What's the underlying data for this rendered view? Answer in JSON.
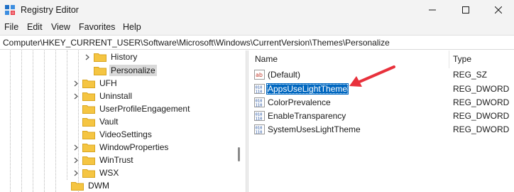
{
  "window": {
    "title": "Registry Editor",
    "controls": {
      "minimize": "minimize",
      "maximize": "maximize",
      "close": "close"
    }
  },
  "menu": [
    "File",
    "Edit",
    "View",
    "Favorites",
    "Help"
  ],
  "address": {
    "path": "Computer\\HKEY_CURRENT_USER\\Software\\Microsoft\\Windows\\CurrentVersion\\Themes\\Personalize"
  },
  "tree": {
    "items": [
      {
        "label": "History",
        "expandable": true,
        "selected": false
      },
      {
        "label": "Personalize",
        "expandable": false,
        "selected": true
      },
      {
        "label": "UFH",
        "expandable": true,
        "selected": false
      },
      {
        "label": "Uninstall",
        "expandable": true,
        "selected": false
      },
      {
        "label": "UserProfileEngagement",
        "expandable": false,
        "selected": false
      },
      {
        "label": "Vault",
        "expandable": false,
        "selected": false
      },
      {
        "label": "VideoSettings",
        "expandable": false,
        "selected": false
      },
      {
        "label": "WindowProperties",
        "expandable": true,
        "selected": false
      },
      {
        "label": "WinTrust",
        "expandable": true,
        "selected": false
      },
      {
        "label": "WSX",
        "expandable": true,
        "selected": false
      },
      {
        "label": "DWM",
        "expandable": false,
        "selected": false
      }
    ]
  },
  "values": {
    "headers": {
      "name": "Name",
      "type": "Type"
    },
    "rows": [
      {
        "name": "(Default)",
        "type": "REG_SZ",
        "icon": "string-value-icon",
        "selected": false
      },
      {
        "name": "AppsUseLightTheme",
        "type": "REG_DWORD",
        "icon": "dword-value-icon",
        "selected": true
      },
      {
        "name": "ColorPrevalence",
        "type": "REG_DWORD",
        "icon": "dword-value-icon",
        "selected": false
      },
      {
        "name": "EnableTransparency",
        "type": "REG_DWORD",
        "icon": "dword-value-icon",
        "selected": false
      },
      {
        "name": "SystemUsesLightTheme",
        "type": "REG_DWORD",
        "icon": "dword-value-icon",
        "selected": false
      }
    ]
  },
  "colors": {
    "selection": "#0067c0",
    "annotation_arrow": "#e8313c",
    "folder": "#f5c542"
  }
}
